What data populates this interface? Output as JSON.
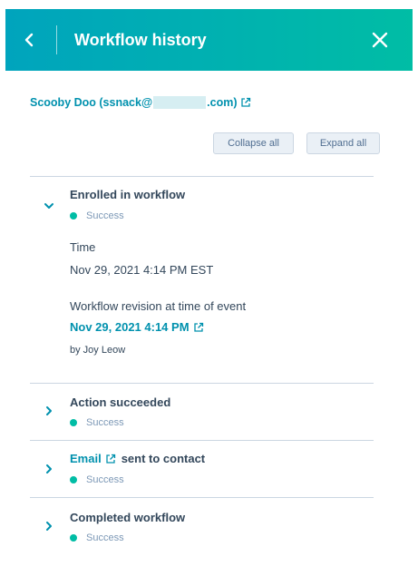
{
  "header": {
    "title": "Workflow history",
    "back_icon": "chevron-left-icon",
    "close_icon": "close-icon"
  },
  "contact": {
    "name_prefix": "Scooby Doo (ssnack@",
    "name_suffix": ".com)",
    "link_icon": "external-link-icon"
  },
  "toolbar": {
    "collapse_label": "Collapse all",
    "expand_label": "Expand all"
  },
  "events": [
    {
      "title": "Enrolled in workflow",
      "status": "Success",
      "expanded": true,
      "time_label": "Time",
      "time_value": "Nov 29, 2021 4:14 PM EST",
      "revision_label": "Workflow revision at time of event",
      "revision_link": "Nov 29, 2021 4:14 PM",
      "revision_by": "by Joy Leow"
    },
    {
      "title": "Action succeeded",
      "status": "Success",
      "expanded": false
    },
    {
      "title_link": "Email",
      "title_rest": "sent to contact",
      "status": "Success",
      "expanded": false
    },
    {
      "title": "Completed workflow",
      "status": "Success",
      "expanded": false
    }
  ],
  "colors": {
    "header_start": "#00a4bd",
    "header_end": "#00bda5",
    "link": "#0091ae",
    "success": "#00bda5"
  }
}
